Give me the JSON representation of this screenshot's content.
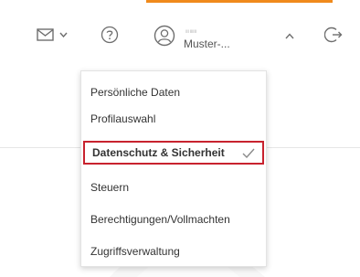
{
  "colors": {
    "accent": "#f08a1c",
    "selected_border": "#c8222e",
    "icon": "#6e6e6e"
  },
  "header": {
    "icons": [
      "mail-icon",
      "chevron-down-icon",
      "help-icon",
      "user-icon",
      "chevron-up-icon",
      "logout-icon"
    ],
    "user": {
      "name_top": "ııı ıııııı",
      "name": "Muster-..."
    }
  },
  "menu": {
    "items": [
      {
        "label": "Persönliche Daten",
        "selected": false
      },
      {
        "label": "Profilauswahl",
        "selected": false
      },
      {
        "label": "Datenschutz & Sicherheit",
        "selected": true
      },
      {
        "label": "Steuern",
        "selected": false
      },
      {
        "label": "Berechtigungen/Vollmachten",
        "selected": false
      },
      {
        "label": "Zugriffsverwaltung",
        "selected": false
      }
    ],
    "selected_icon": "checkmark-icon"
  }
}
